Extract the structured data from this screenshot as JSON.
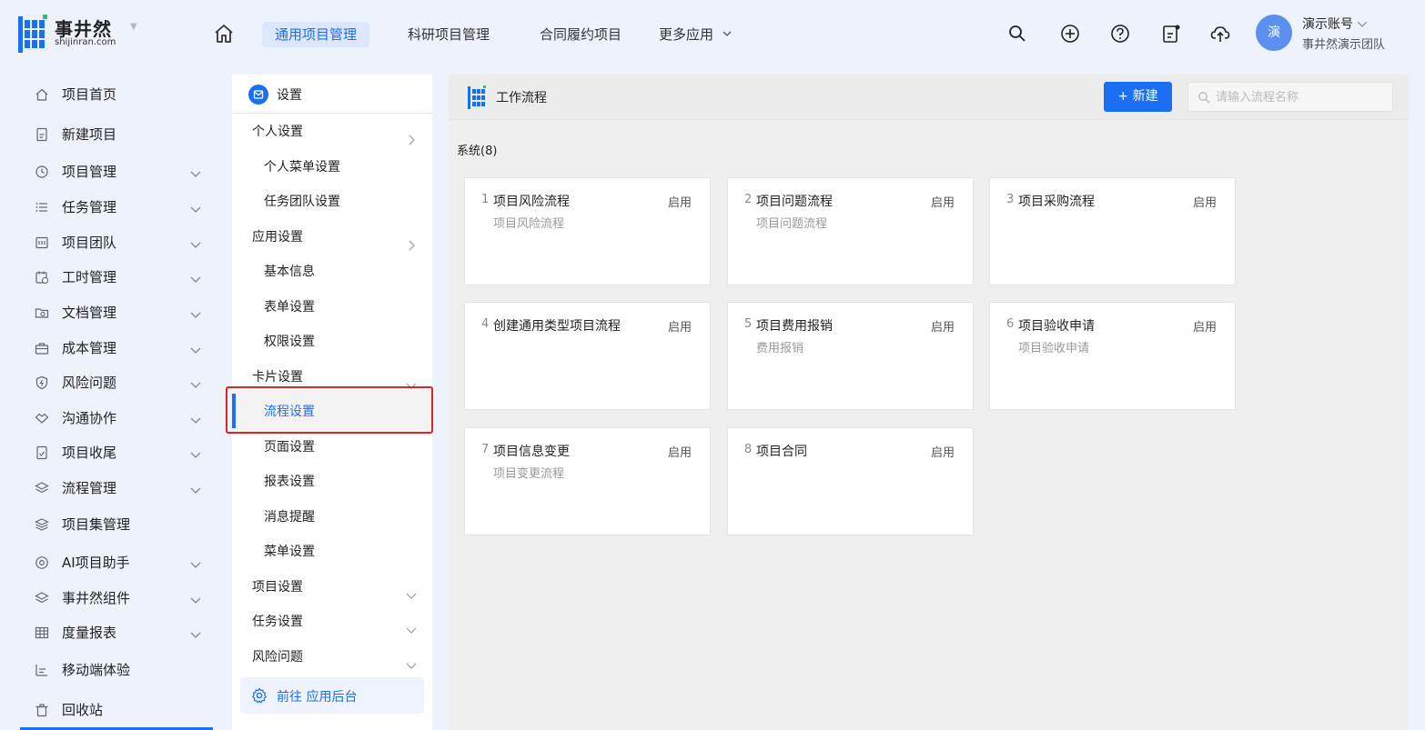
{
  "brand": {
    "name": "事井然",
    "domain": "shijinran.com",
    "accent": "#1a6ff5",
    "logo_green": "#2fc36a"
  },
  "topnav": {
    "items": [
      "通用项目管理",
      "科研项目管理",
      "合同履约项目",
      "更多应用"
    ],
    "active_index": 0
  },
  "user": {
    "avatar_text": "演",
    "account": "演示账号",
    "team": "事井然演示团队"
  },
  "sidebar": {
    "items": [
      {
        "label": "项目首页",
        "icon": "home-outline-icon",
        "chevron": false
      },
      {
        "label": "新建项目",
        "icon": "doc-plus-icon",
        "chevron": false
      },
      {
        "label": "项目管理",
        "icon": "clock-icon",
        "chevron": true
      },
      {
        "label": "任务管理",
        "icon": "list-icon",
        "chevron": true
      },
      {
        "label": "项目团队",
        "icon": "team-icon",
        "chevron": true
      },
      {
        "label": "工时管理",
        "icon": "calendar-clock-icon",
        "chevron": true
      },
      {
        "label": "文档管理",
        "icon": "folder-search-icon",
        "chevron": true
      },
      {
        "label": "成本管理",
        "icon": "briefcase-icon",
        "chevron": true
      },
      {
        "label": "风险问题",
        "icon": "shield-icon",
        "chevron": true
      },
      {
        "label": "沟通协作",
        "icon": "handshake-icon",
        "chevron": true
      },
      {
        "label": "项目收尾",
        "icon": "doc-check-icon",
        "chevron": true
      },
      {
        "label": "流程管理",
        "icon": "layers-icon",
        "chevron": true
      },
      {
        "label": "项目集管理",
        "icon": "stack-icon",
        "chevron": false
      },
      {
        "label": "AI项目助手",
        "icon": "at-icon",
        "chevron": true
      },
      {
        "label": "事井然组件",
        "icon": "layers-icon",
        "chevron": true
      },
      {
        "label": "度量报表",
        "icon": "table-icon",
        "chevron": true
      },
      {
        "label": "移动端体验",
        "icon": "bar-chart-icon",
        "chevron": false
      },
      {
        "label": "回收站",
        "icon": "trash-icon",
        "chevron": false
      }
    ]
  },
  "settings": {
    "title": "设置",
    "groups": [
      {
        "label": "个人设置",
        "arrow": "right"
      },
      {
        "label": "个人菜单设置"
      },
      {
        "label": "任务团队设置"
      },
      {
        "label": "应用设置",
        "arrow": "right"
      },
      {
        "label": "基本信息"
      },
      {
        "label": "表单设置"
      },
      {
        "label": "权限设置"
      },
      {
        "label": "卡片设置",
        "arrow": "down"
      },
      {
        "label": "流程设置"
      },
      {
        "label": "页面设置"
      },
      {
        "label": "报表设置"
      },
      {
        "label": "消息提醒"
      },
      {
        "label": "菜单设置"
      },
      {
        "label": "项目设置",
        "arrow": "down"
      },
      {
        "label": "任务设置",
        "arrow": "down"
      },
      {
        "label": "风险问题",
        "arrow": "down"
      }
    ],
    "selected": "流程设置",
    "goto_label": "前往 应用后台"
  },
  "workflow": {
    "title": "工作流程",
    "new_button": "+ 新建",
    "search_placeholder": "请输入流程名称",
    "section_title": "系统(8)",
    "cards": [
      {
        "num": "1",
        "name": "项目风险流程",
        "status": "启用",
        "desc": "项目风险流程"
      },
      {
        "num": "2",
        "name": "项目问题流程",
        "status": "启用",
        "desc": "项目问题流程"
      },
      {
        "num": "3",
        "name": "项目采购流程",
        "status": "启用",
        "desc": ""
      },
      {
        "num": "4",
        "name": "创建通用类型项目流程",
        "status": "启用",
        "desc": ""
      },
      {
        "num": "5",
        "name": "项目费用报销",
        "status": "启用",
        "desc": "费用报销"
      },
      {
        "num": "6",
        "name": "项目验收申请",
        "status": "启用",
        "desc": "项目验收申请"
      },
      {
        "num": "7",
        "name": "项目信息变更",
        "status": "启用",
        "desc": "项目变更流程"
      },
      {
        "num": "8",
        "name": "项目合同",
        "status": "启用",
        "desc": ""
      }
    ]
  }
}
